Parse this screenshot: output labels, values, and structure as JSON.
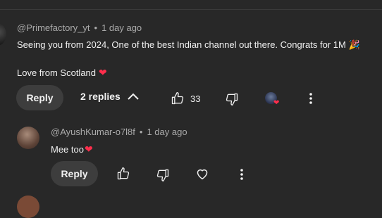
{
  "comment": {
    "author": "@Primefactory_yt",
    "time": "1 day ago",
    "text_line1": "Seeing you from 2024, One of the best Indian channel out there. Congrats for 1M",
    "text_line1_emoji": "🎉",
    "text_line2": "Love from Scotland",
    "heart": "❤",
    "reply_label": "Reply",
    "replies_label": "2 replies",
    "like_count": "33"
  },
  "reply": {
    "author": "@AyushKumar-o7l8f",
    "time": "1 day ago",
    "text": "Mee too",
    "heart": "❤",
    "reply_label": "Reply"
  },
  "separator": "•",
  "colors": {
    "background": "#282828",
    "text": "#f1f1f1",
    "muted": "#aaaaaa",
    "button": "#3d3d3d",
    "heart": "#ff2e4c"
  }
}
